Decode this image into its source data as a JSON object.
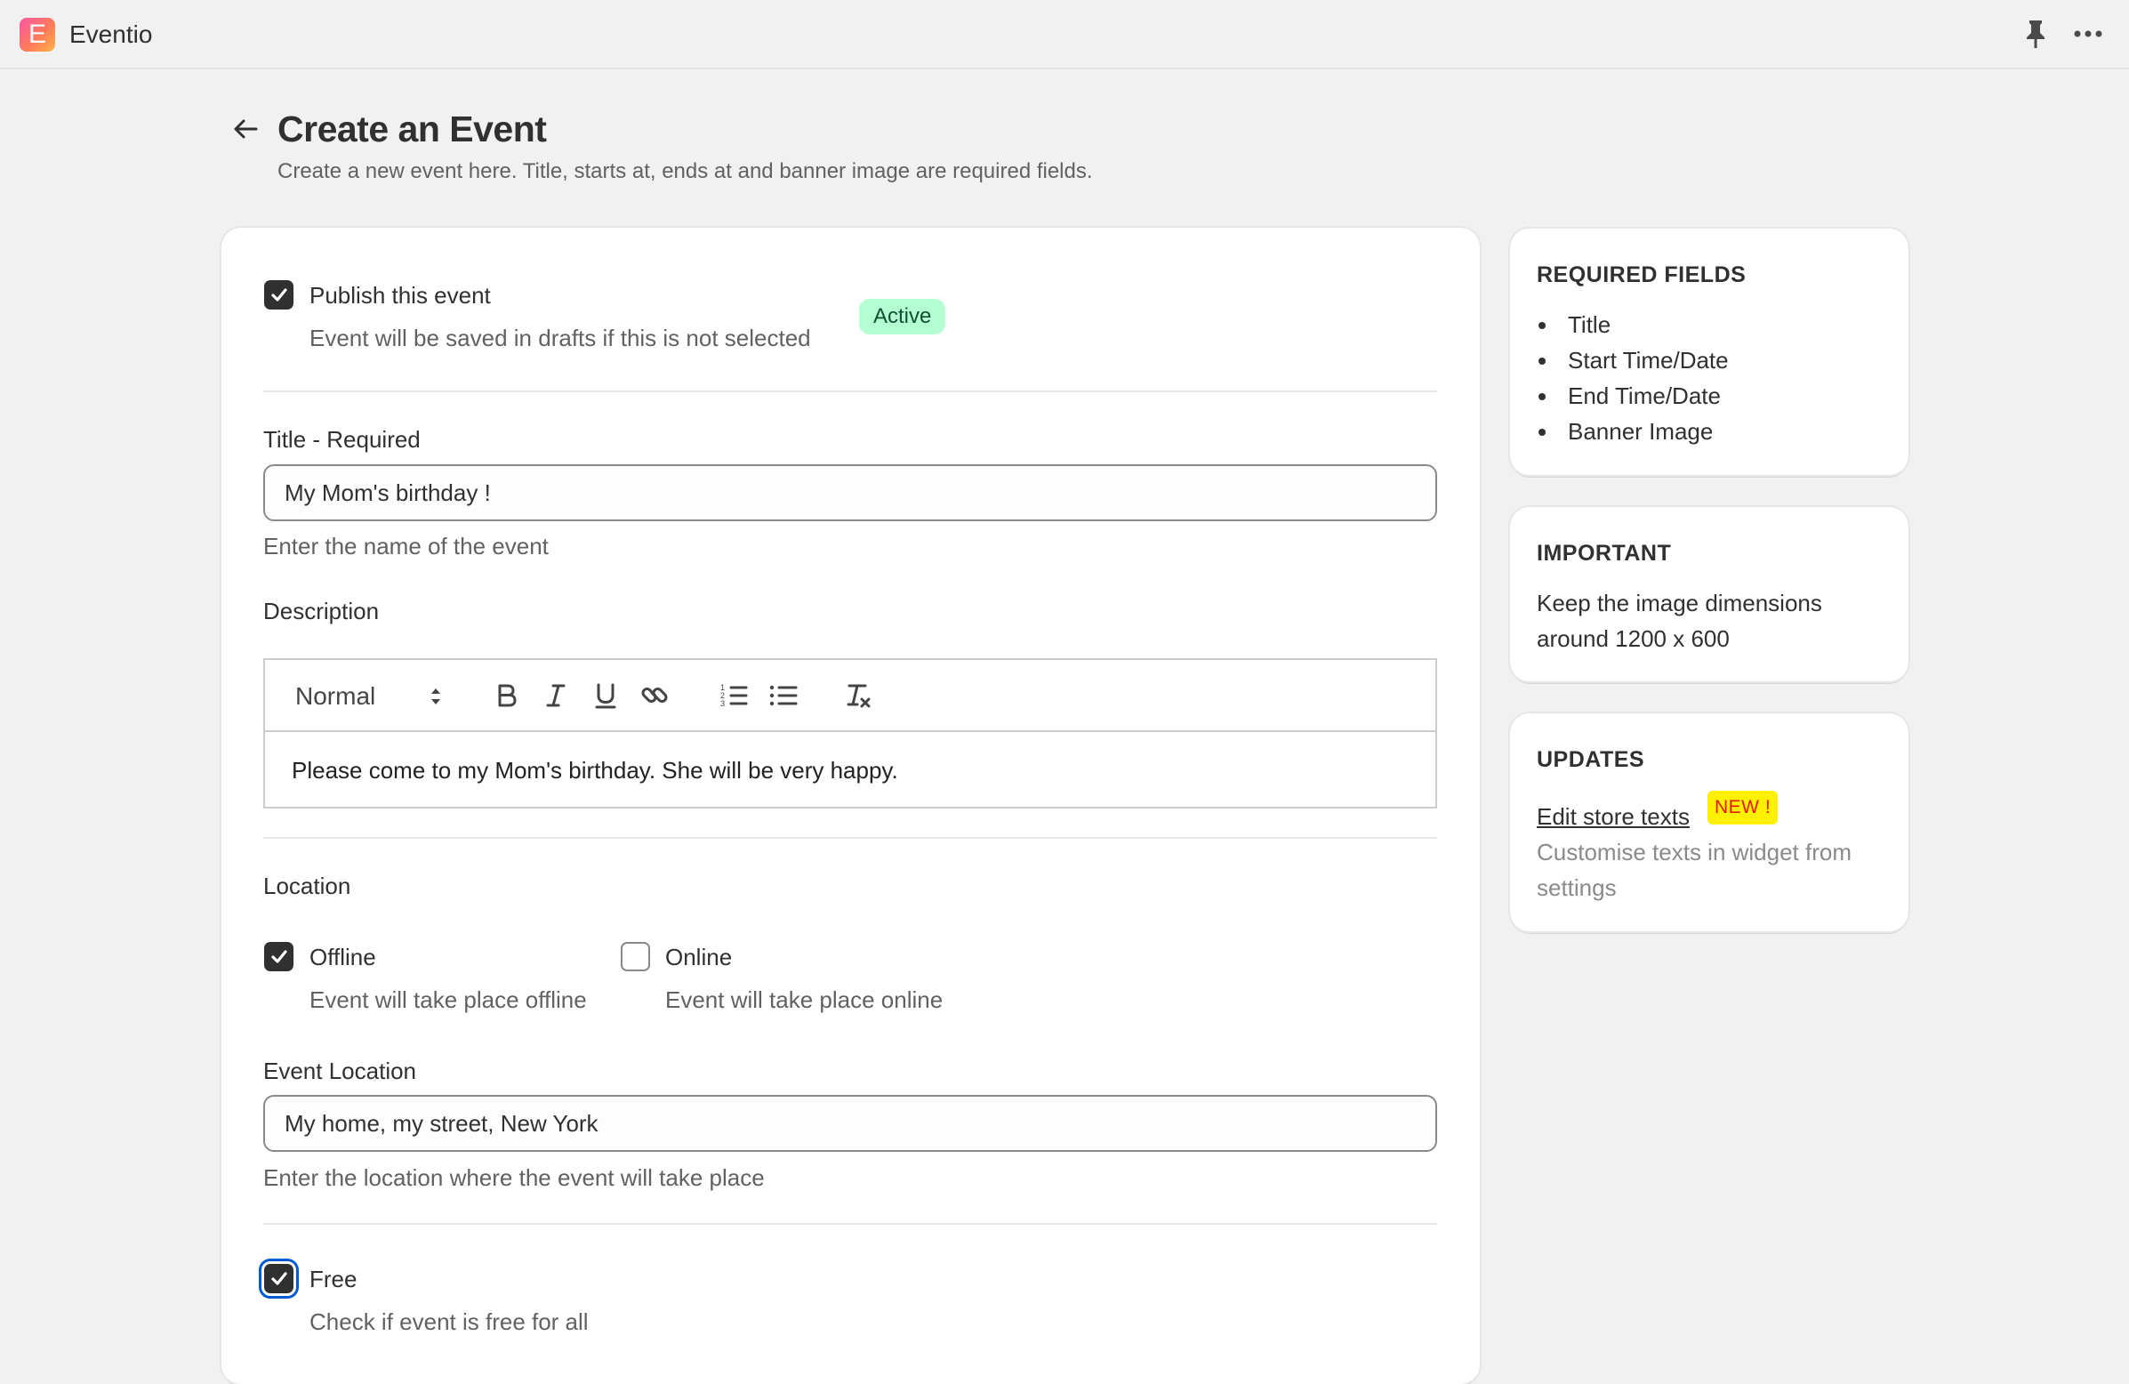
{
  "app": {
    "name": "Eventio",
    "logo_letter": "E"
  },
  "top_actions": {
    "pin_icon": "pin-icon",
    "more_icon": "more-horizontal-icon"
  },
  "header": {
    "back_icon": "arrow-left-icon",
    "title": "Create an Event",
    "subtitle": "Create a new event here. Title, starts at, ends at and banner image are required fields."
  },
  "publish": {
    "checked": true,
    "label": "Publish this event",
    "help": "Event will be saved in drafts if this is not selected",
    "badge": "Active"
  },
  "title_field": {
    "label": "Title - Required",
    "value": "My Mom's birthday !",
    "help": "Enter the name of the event"
  },
  "description": {
    "label": "Description",
    "format": "Normal",
    "toolbar": [
      "bold-icon",
      "italic-icon",
      "underline-icon",
      "link-icon",
      "ordered-list-icon",
      "bullet-list-icon",
      "clear-format-icon"
    ],
    "content": "Please come to my Mom's birthday. She will be very happy."
  },
  "location": {
    "label": "Location",
    "offline": {
      "checked": true,
      "label": "Offline",
      "help": "Event will take place offline"
    },
    "online": {
      "checked": false,
      "label": "Online",
      "help": "Event will take place online"
    }
  },
  "event_location": {
    "label": "Event Location",
    "value": "My home, my street, New York",
    "help": "Enter the location where the event will take place"
  },
  "free": {
    "checked": true,
    "label": "Free",
    "help": "Check if event is free for all"
  },
  "sidebar": {
    "required": {
      "title": "REQUIRED FIELDS",
      "items": [
        "Title",
        "Start Time/Date",
        "End Time/Date",
        "Banner Image"
      ]
    },
    "important": {
      "title": "IMPORTANT",
      "line1": "Keep the image dimensions",
      "line2": "around 1200 x 600"
    },
    "updates": {
      "title": "UPDATES",
      "link": "Edit store texts",
      "badge": "NEW !",
      "description": "Customise texts in widget from settings"
    }
  },
  "colors": {
    "background": "#f1f1f1",
    "card": "#ffffff",
    "checkbox": "#303030",
    "focus_ring": "#005bd3",
    "active_badge_bg": "#b4fed2",
    "active_badge_text": "#0c5132",
    "new_badge_bg": "#ffef00",
    "new_badge_text": "#e51c00"
  }
}
